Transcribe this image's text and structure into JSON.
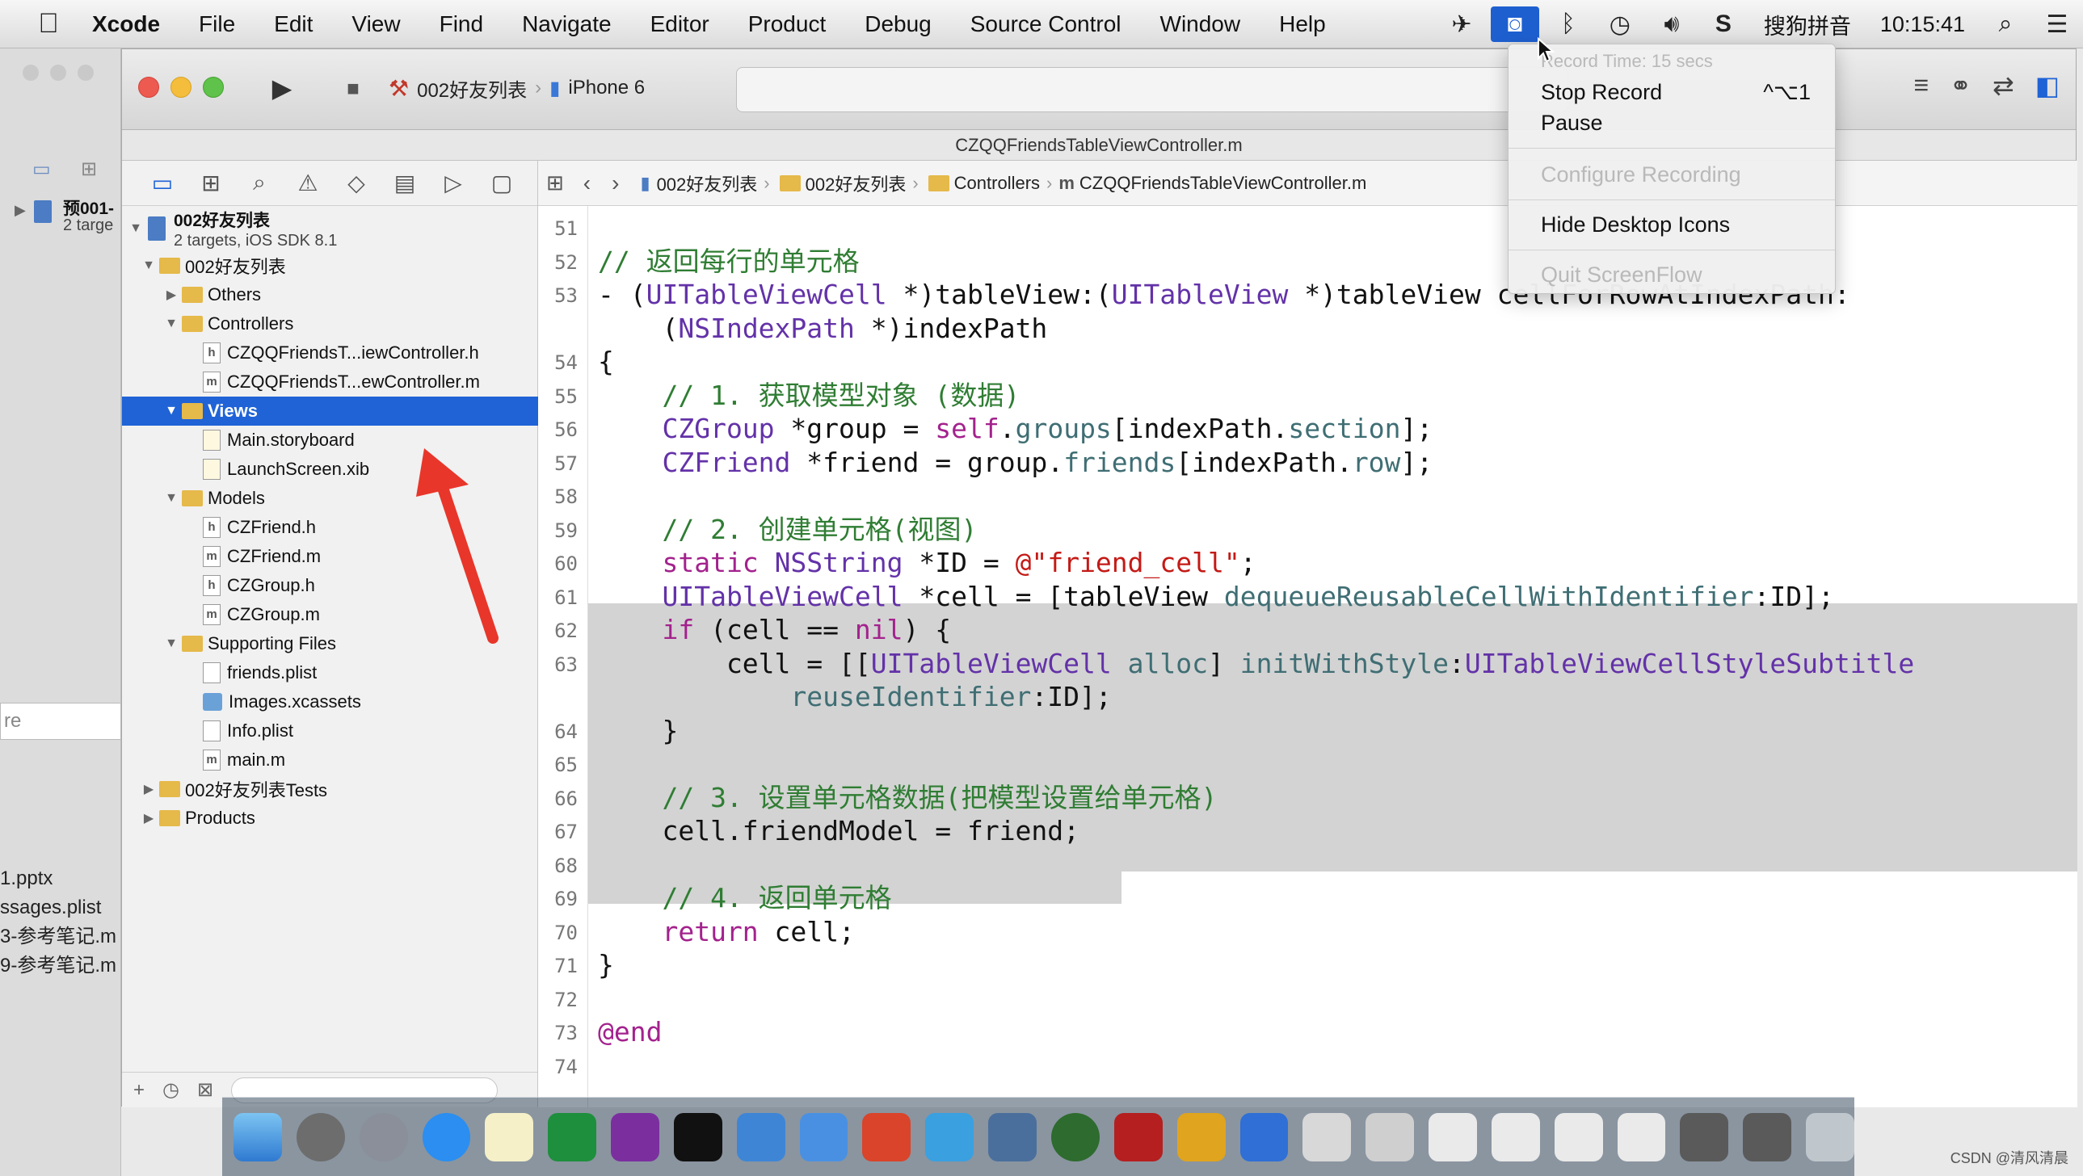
{
  "menubar": {
    "app": "Xcode",
    "items": [
      "File",
      "Edit",
      "View",
      "Find",
      "Navigate",
      "Editor",
      "Product",
      "Debug",
      "Source Control",
      "Window",
      "Help"
    ],
    "input_method": "搜狗拼音",
    "clock": "10:15:41"
  },
  "background_window": {
    "project_name": "预001-",
    "project_sub": "2 targe",
    "search_placeholder": "re",
    "files": [
      "1.pptx",
      "ssages.plist",
      "3-参考笔记.m",
      "9-参考笔记.m"
    ]
  },
  "toolbar": {
    "scheme": "002好友列表",
    "device": "iPhone 6"
  },
  "window_title": "CZQQFriendsTableViewController.m",
  "jumpbar": {
    "crumbs": [
      "002好友列表",
      "002好友列表",
      "Controllers",
      "CZQQFriendsTableViewController.m"
    ]
  },
  "navigator": {
    "project": {
      "name": "002好友列表",
      "subtitle": "2 targets, iOS SDK 8.1"
    },
    "rows": [
      {
        "label": "002好友列表"
      },
      {
        "label": "Others"
      },
      {
        "label": "Controllers"
      },
      {
        "label": "CZQQFriendsT...iewController.h",
        "badge": "h"
      },
      {
        "label": "CZQQFriendsT...ewController.m",
        "badge": "m"
      },
      {
        "label": "Views"
      },
      {
        "label": "Main.storyboard"
      },
      {
        "label": "LaunchScreen.xib"
      },
      {
        "label": "Models"
      },
      {
        "label": "CZFriend.h",
        "badge": "h"
      },
      {
        "label": "CZFriend.m",
        "badge": "m"
      },
      {
        "label": "CZGroup.h",
        "badge": "h"
      },
      {
        "label": "CZGroup.m",
        "badge": "m"
      },
      {
        "label": "Supporting Files"
      },
      {
        "label": "friends.plist"
      },
      {
        "label": "Images.xcassets"
      },
      {
        "label": "Info.plist"
      },
      {
        "label": "main.m",
        "badge": "m"
      },
      {
        "label": "002好友列表Tests"
      },
      {
        "label": "Products"
      }
    ]
  },
  "code_lines": [
    {
      "n": "51",
      "parts": []
    },
    {
      "n": "52",
      "parts": [
        [
          "cm",
          "// 返回每行的单元格"
        ]
      ]
    },
    {
      "n": "53",
      "parts": [
        [
          "",
          "- ("
        ],
        [
          "ty",
          "UITableViewCell"
        ],
        [
          "",
          " *)tableView:("
        ],
        [
          "ty",
          "UITableView"
        ],
        [
          "",
          " *)tableView cellForRowAtIndexPath:"
        ]
      ]
    },
    {
      "n": "",
      "parts": [
        [
          "",
          "    ("
        ],
        [
          "ty",
          "NSIndexPath"
        ],
        [
          "",
          " *)indexPath"
        ]
      ]
    },
    {
      "n": "54",
      "parts": [
        [
          "",
          "{"
        ]
      ]
    },
    {
      "n": "55",
      "parts": [
        [
          "cm",
          "    // 1. 获取模型对象 (数据)"
        ]
      ]
    },
    {
      "n": "56",
      "parts": [
        [
          "ty",
          "    CZGroup"
        ],
        [
          "",
          " *group = "
        ],
        [
          "kw",
          "self"
        ],
        [
          "",
          "."
        ],
        [
          "fn",
          "groups"
        ],
        [
          "",
          "[indexPath."
        ],
        [
          "fn",
          "section"
        ],
        [
          "",
          "];"
        ]
      ]
    },
    {
      "n": "57",
      "parts": [
        [
          "ty",
          "    CZFriend"
        ],
        [
          "",
          " *friend = group."
        ],
        [
          "fn",
          "friends"
        ],
        [
          "",
          "[indexPath."
        ],
        [
          "fn",
          "row"
        ],
        [
          "",
          "];"
        ]
      ]
    },
    {
      "n": "58",
      "parts": []
    },
    {
      "n": "59",
      "parts": [
        [
          "cm",
          "    // 2. 创建单元格(视图)"
        ]
      ]
    },
    {
      "n": "60",
      "parts": [
        [
          "kw",
          "    static"
        ],
        [
          "",
          " "
        ],
        [
          "ty",
          "NSString"
        ],
        [
          "",
          " *ID = "
        ],
        [
          "st",
          "@\"friend_cell\""
        ],
        [
          "",
          ";"
        ]
      ]
    },
    {
      "n": "61",
      "parts": [
        [
          "ty",
          "    UITableViewCell"
        ],
        [
          "",
          " *cell = [tableView "
        ],
        [
          "fn",
          "dequeueReusableCellWithIdentifier"
        ],
        [
          "",
          ":ID];"
        ]
      ]
    },
    {
      "n": "62",
      "parts": [
        [
          "kw",
          "    if"
        ],
        [
          "",
          " (cell == "
        ],
        [
          "kw",
          "nil"
        ],
        [
          "",
          ") {"
        ]
      ]
    },
    {
      "n": "63",
      "parts": [
        [
          "",
          "        cell = [["
        ],
        [
          "ty",
          "UITableViewCell"
        ],
        [
          "",
          " "
        ],
        [
          "fn",
          "alloc"
        ],
        [
          "",
          "] "
        ],
        [
          "fn",
          "initWithStyle"
        ],
        [
          "",
          ":"
        ],
        [
          "ty",
          "UITableViewCellStyleSubtitle"
        ]
      ]
    },
    {
      "n": "",
      "parts": [
        [
          "fn",
          "            reuseIdentifier"
        ],
        [
          "",
          ":ID];"
        ]
      ]
    },
    {
      "n": "64",
      "parts": [
        [
          "",
          "    }"
        ]
      ]
    },
    {
      "n": "65",
      "parts": []
    },
    {
      "n": "66",
      "parts": [
        [
          "cm",
          "    // 3. 设置单元格数据(把模型设置给单元格)"
        ]
      ]
    },
    {
      "n": "67",
      "parts": [
        [
          "",
          "    cell.friendModel = friend;"
        ]
      ]
    },
    {
      "n": "68",
      "parts": []
    },
    {
      "n": "69",
      "parts": [
        [
          "cm",
          "    // 4. 返回单元格"
        ]
      ]
    },
    {
      "n": "70",
      "parts": [
        [
          "kw",
          "    return"
        ],
        [
          "",
          " cell;"
        ]
      ]
    },
    {
      "n": "71",
      "parts": [
        [
          "",
          "}"
        ]
      ]
    },
    {
      "n": "72",
      "parts": []
    },
    {
      "n": "73",
      "parts": [
        [
          "kw",
          "@end"
        ]
      ]
    },
    {
      "n": "74",
      "parts": []
    }
  ],
  "dropdown": {
    "header": "Record Time: 15 secs",
    "items": [
      {
        "label": "Stop Record",
        "shortcut": "^⌥1",
        "enabled": true
      },
      {
        "label": "Pause",
        "enabled": true
      },
      {
        "label": "Configure Recording",
        "enabled": false
      },
      {
        "label": "Hide Desktop Icons",
        "enabled": true
      },
      {
        "label": "Quit ScreenFlow",
        "enabled": false
      }
    ]
  },
  "colors": {
    "accent": "#1f63d6",
    "comment": "#2f7d33",
    "keyword": "#a3228d",
    "type": "#6332a8",
    "string": "#c41a16",
    "highlight": "#d3d3d3",
    "annotation_arrow": "#e8362a"
  },
  "watermark": "CSDN @清风清晨"
}
